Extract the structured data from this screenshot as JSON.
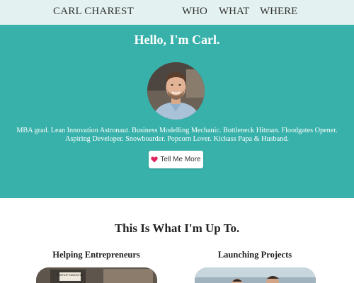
{
  "nav": {
    "brand": "CARL CHAREST",
    "links": [
      "WHO",
      "WHAT",
      "WHERE"
    ]
  },
  "hero": {
    "title": "Hello, I'm Carl.",
    "bio": "MBA grad. Lean Innovation Astronaut. Business Modelling Mechanic. Bottleneck Hitman. Floodgates Opener. Aspiring Developer. Snowboarder. Popcorn Lover. Kickass Papa & Husband.",
    "cta_label": "Tell Me More",
    "cta_icon": "heart-icon"
  },
  "section": {
    "title": "This Is What I'm Up To.",
    "columns": [
      {
        "title": "Helping Entrepreneurs"
      },
      {
        "title": "Launching Projects"
      }
    ],
    "thumb1_text": "STARTUP EDMONTON"
  },
  "colors": {
    "hero_bg": "#38b1aa",
    "nav_bg": "#e3f2f0",
    "heart": "#e0245e"
  }
}
